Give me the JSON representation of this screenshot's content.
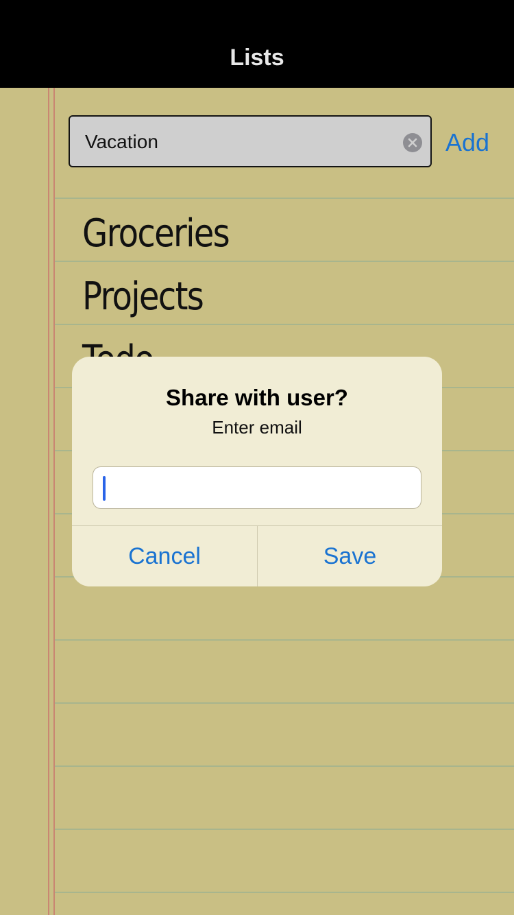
{
  "navbar": {
    "title": "Lists"
  },
  "new_list": {
    "value": "Vacation",
    "add_label": "Add"
  },
  "lists": {
    "items": [
      {
        "label": "Groceries"
      },
      {
        "label": "Projects"
      },
      {
        "label": "Todo"
      }
    ]
  },
  "alert": {
    "title": "Share with user?",
    "message": "Enter email",
    "email_value": "",
    "cancel_label": "Cancel",
    "save_label": "Save"
  },
  "colors": {
    "accent": "#1a73d1",
    "paper": "#c9bf84",
    "navbar": "#000000",
    "margin_line": "#c98672",
    "rule_line": "#a8b58d",
    "alert_background": "#f1edd5"
  },
  "icons": {
    "clear": "clear-icon"
  }
}
